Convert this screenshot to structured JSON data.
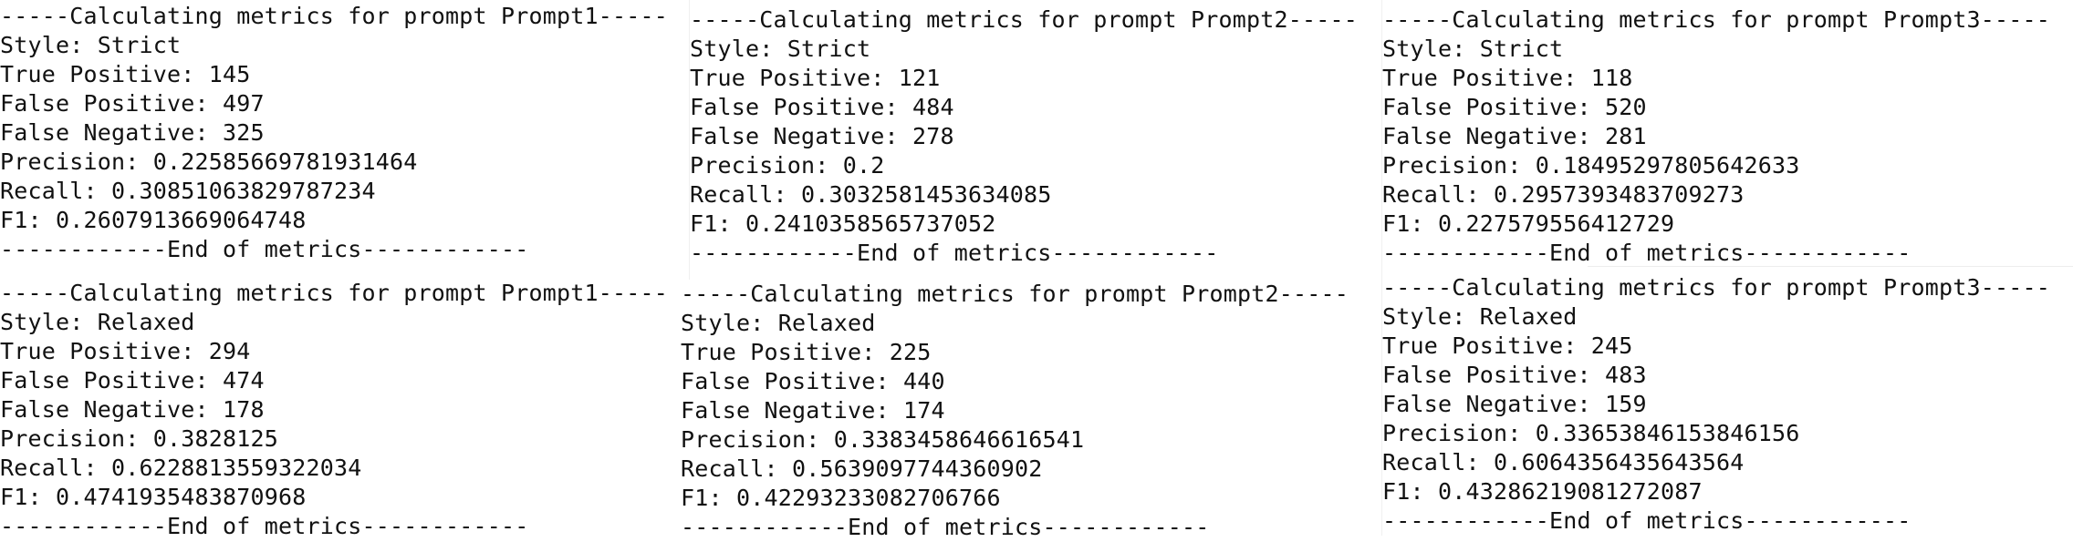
{
  "panels": [
    {
      "header": "-----Calculating metrics for prompt Prompt1-----",
      "style": "Style: Strict",
      "true_positive": "True Positive: 145",
      "false_positive": "False Positive: 497",
      "false_negative": "False Negative: 325",
      "precision": "Precision: 0.22585669781931464",
      "recall": "Recall: 0.30851063829787234",
      "f1": "F1: 0.2607913669064748",
      "footer": "------------End of metrics------------"
    },
    {
      "header": "-----Calculating metrics for prompt Prompt2-----",
      "style": "Style: Strict",
      "true_positive": "True Positive: 121",
      "false_positive": "False Positive: 484",
      "false_negative": "False Negative: 278",
      "precision": "Precision: 0.2",
      "recall": "Recall: 0.3032581453634085",
      "f1": "F1: 0.2410358565737052",
      "footer": "------------End of metrics------------"
    },
    {
      "header": "-----Calculating metrics for prompt Prompt3-----",
      "style": "Style: Strict",
      "true_positive": "True Positive: 118",
      "false_positive": "False Positive: 520",
      "false_negative": "False Negative: 281",
      "precision": "Precision: 0.18495297805642633",
      "recall": "Recall: 0.2957393483709273",
      "f1": "F1: 0.227579556412729",
      "footer": "------------End of metrics------------"
    },
    {
      "header": "-----Calculating metrics for prompt Prompt1-----",
      "style": "Style: Relaxed",
      "true_positive": "True Positive: 294",
      "false_positive": "False Positive: 474",
      "false_negative": "False Negative: 178",
      "precision": "Precision: 0.3828125",
      "recall": "Recall: 0.6228813559322034",
      "f1": "F1: 0.4741935483870968",
      "footer": "------------End of metrics------------"
    },
    {
      "header": "-----Calculating metrics for prompt Prompt2-----",
      "style": "Style: Relaxed",
      "true_positive": "True Positive: 225",
      "false_positive": "False Positive: 440",
      "false_negative": "False Negative: 174",
      "precision": "Precision: 0.3383458646616541",
      "recall": "Recall: 0.5639097744360902",
      "f1": "F1: 0.42293233082706766",
      "footer": "------------End of metrics------------"
    },
    {
      "header": "-----Calculating metrics for prompt Prompt3-----",
      "style": "Style: Relaxed",
      "true_positive": "True Positive: 245",
      "false_positive": "False Positive: 483",
      "false_negative": "False Negative: 159",
      "precision": "Precision: 0.33653846153846156",
      "recall": "Recall: 0.6064356435643564",
      "f1": "F1: 0.43286219081272087",
      "footer": "------------End of metrics------------"
    }
  ]
}
